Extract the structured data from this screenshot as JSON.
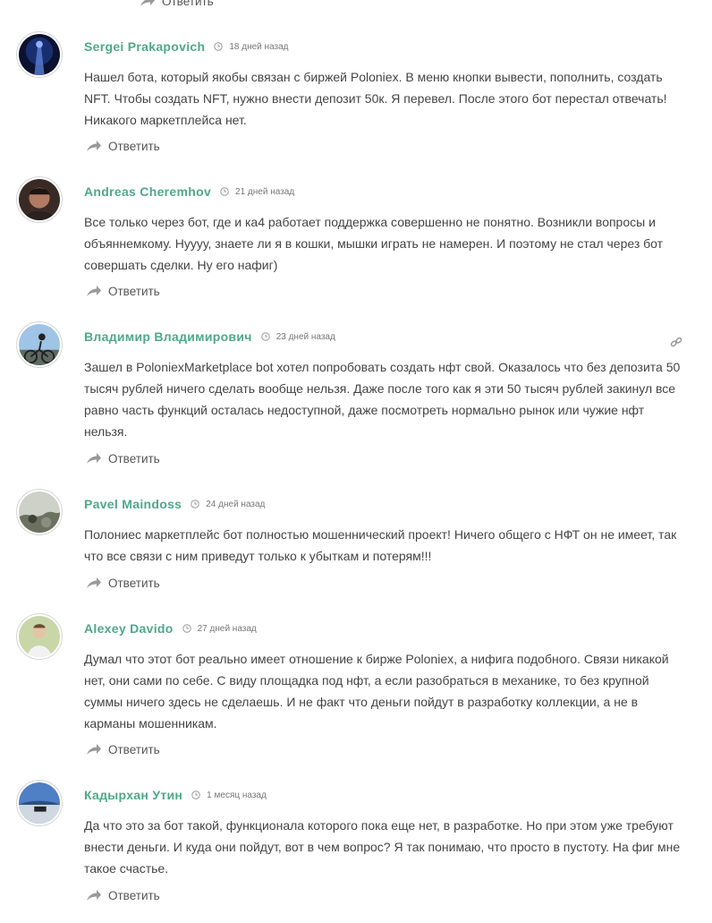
{
  "colors": {
    "author": "#4fa88a",
    "text": "#444444",
    "meta": "#777777",
    "icon": "#999999"
  },
  "top_reply": {
    "label": "Ответить",
    "icon": "reply-arrow-icon"
  },
  "comments": [
    {
      "author": "Sergei Prakapovich",
      "date": "18 дней назад",
      "text": "Нашел бота, который якобы связан с биржей Poloniex. В меню кнопки вывести, пополнить, создать NFT. Чтобы создать NFT, нужно внести депозит 50к. Я перевел. После этого бот перестал отвечать! Никакого маркетплейса нет.",
      "reply": "Ответить"
    },
    {
      "author": "Andreas Cheremhov",
      "date": "21 дней назад",
      "text": "Все только через бот, где и ка4 работает поддержка совершенно не понятно. Возникли вопросы и объяннемкому. Нуууу, знаете ли я в кошки, мышки играть не намерен. И поэтому не стал через бот совершать сделки. Ну его нафиг)",
      "reply": "Ответить"
    },
    {
      "author": "Владимир Владимирович",
      "date": "23 дней назад",
      "text": "Зашел в PoloniexMarketplace bot хотел попробовать создать нфт свой. Оказалось что без депозита 50 тысяч рублей ничего сделать вообще нельзя. Даже после того как я эти 50 тысяч рублей закинул все равно часть функций осталась недоступной, даже посмотреть нормально рынок или чужие нфт нельзя.",
      "reply": "Ответить",
      "link_icon": "link-icon"
    },
    {
      "author": "Pavel Maindoss",
      "date": "24 дней назад",
      "text": "Полониес маркетплейс бот полностью мошеннический проект! Ничего общего с НФТ он не имеет, так что все связи с ним приведут только к убыткам и потерям!!!",
      "reply": "Ответить"
    },
    {
      "author": "Alexey Davido",
      "date": "27 дней назад",
      "text": "Думал что этот бот реально имеет отношение к бирже Poloniex, а нифига подобного. Связи никакой нет, они сами по себе. С виду площадка под нфт, а если разобраться в механике, то без крупной суммы ничего здесь не сделаешь. И не факт что деньги пойдут в разработку коллекции, а не в карманы мошенникам.",
      "reply": "Ответить"
    },
    {
      "author": "Кадырхан Утин",
      "date": "1 месяц назад",
      "text": "Да что это за бот такой, функционала которого пока еще нет, в разработке. Но при этом уже требуют внести деньги. И куда они пойдут, вот в чем вопрос? Я так понимаю, что просто в пустоту. На фиг мне такое счастье.",
      "reply": "Ответить"
    }
  ]
}
